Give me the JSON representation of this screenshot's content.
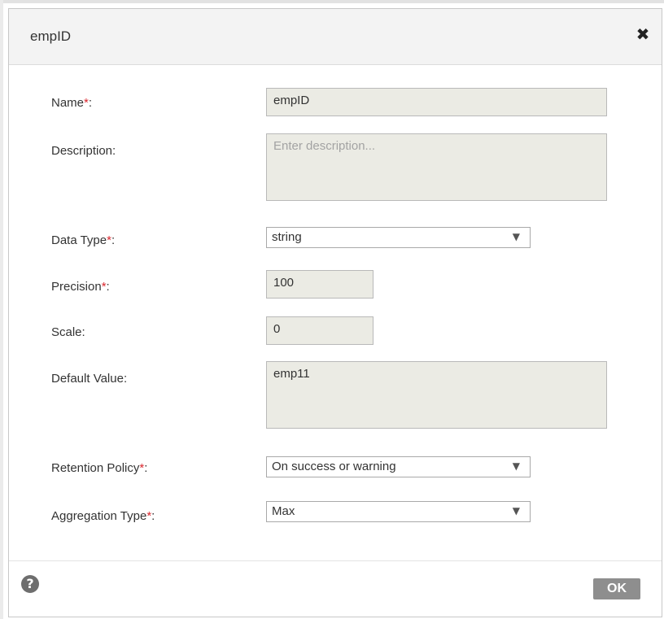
{
  "dialog": {
    "title": "empID",
    "close_glyph": "✖",
    "help_glyph": "?",
    "ok_label": "OK"
  },
  "required_marker": "*",
  "fields": {
    "name": {
      "label": "Name",
      "value": "empID"
    },
    "description": {
      "label": "Description:",
      "value": "",
      "placeholder": "Enter description..."
    },
    "data_type": {
      "label": "Data Type",
      "value": "string"
    },
    "precision": {
      "label": "Precision",
      "value": "100"
    },
    "scale": {
      "label": "Scale:",
      "value": "0"
    },
    "default_value": {
      "label": "Default Value:",
      "value": "emp11"
    },
    "retention_policy": {
      "label": "Retention Policy",
      "value": "On success or warning"
    },
    "aggregation_type": {
      "label": "Aggregation Type",
      "value": "Max"
    }
  },
  "select_arrow": "▼",
  "icons": {
    "close": "close-icon",
    "help": "help-icon",
    "dropdown": "chevron-down-icon"
  },
  "colors": {
    "header_bg": "#f3f3f3",
    "field_bg": "#ebebe4",
    "required": "#d9282f",
    "ok_button": "#8e8e8e"
  }
}
